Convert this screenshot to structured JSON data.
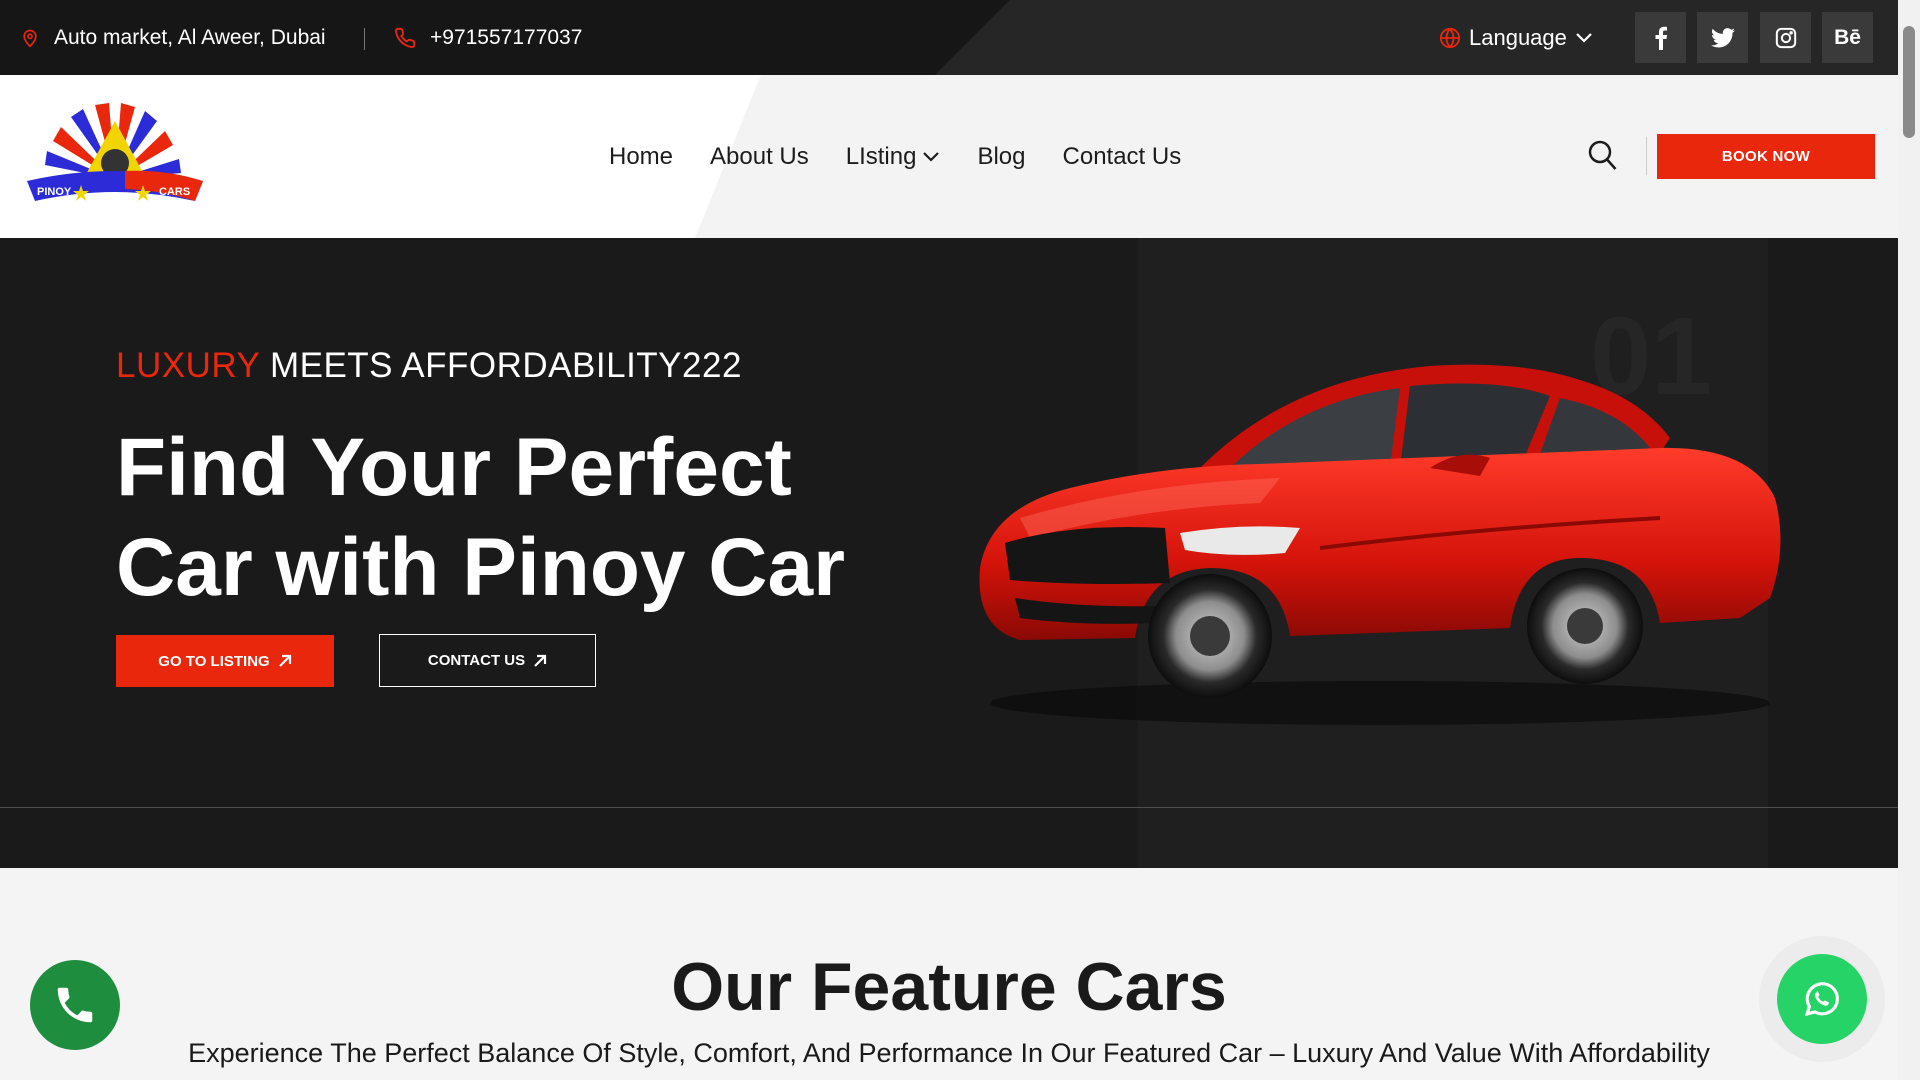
{
  "topbar": {
    "address": "Auto market, Al Aweer, Dubai",
    "phone": "+971557177037",
    "language_label": "Language",
    "social": [
      {
        "icon": "facebook-icon",
        "label": "f"
      },
      {
        "icon": "twitter-icon",
        "label": ""
      },
      {
        "icon": "instagram-icon",
        "label": ""
      },
      {
        "icon": "behance-icon",
        "label": "Bē"
      }
    ]
  },
  "header": {
    "nav": {
      "home": "Home",
      "about": "About Us",
      "listing": "LIsting",
      "blog": "Blog",
      "contact": "Contact Us"
    },
    "book_label": "BOOK NOW"
  },
  "hero": {
    "eyebrow_highlight": "LUXURY",
    "eyebrow_rest": " MEETS AFFORDABILITY222",
    "title_line1": "Find Your Perfect",
    "title_line2": "Car with Pinoy Car",
    "btn_listing": "GO TO LISTING",
    "btn_contact": "CONTACT US"
  },
  "features": {
    "title": "Our Feature Cars",
    "subtitle": "Experience The Perfect Balance Of Style, Comfort, And Performance In Our Featured Car – Luxury And Value With Affordability"
  },
  "colors": {
    "accent": "#e8270d",
    "topbar_bg": "#161616",
    "hero_bg": "#1a1a1a",
    "whatsapp": "#25d366",
    "phone_fab": "#1e8e3e"
  }
}
